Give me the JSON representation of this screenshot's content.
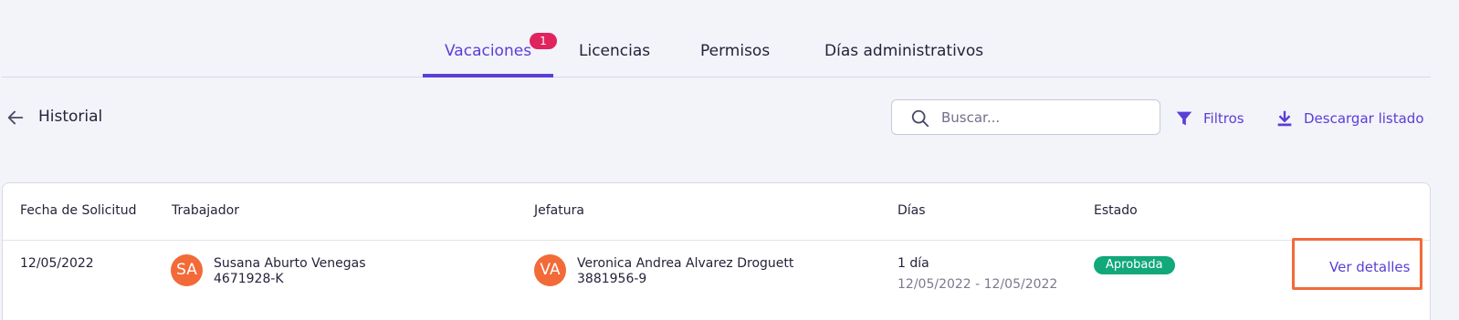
{
  "tabs": [
    {
      "label": "Vacaciones",
      "badge": "1",
      "active": true
    },
    {
      "label": "Licencias"
    },
    {
      "label": "Permisos"
    },
    {
      "label": "Días administrativos"
    }
  ],
  "section": {
    "title": "Historial"
  },
  "search": {
    "placeholder": "Buscar..."
  },
  "actions": {
    "filters_label": "Filtros",
    "download_label": "Descargar listado"
  },
  "table": {
    "headers": [
      "Fecha de Solicitud",
      "Trabajador",
      "Jefatura",
      "Días",
      "Estado"
    ],
    "rows": [
      {
        "date": "12/05/2022",
        "worker": {
          "initials": "SA",
          "name": "Susana Aburto Venegas",
          "id": "4671928-K"
        },
        "manager": {
          "initials": "VA",
          "name": "Veronica Andrea Alvarez Droguett",
          "id": "3881956-9"
        },
        "days": {
          "count": "1 día",
          "range": "12/05/2022 - 12/05/2022"
        },
        "status": "Aprobada",
        "details_label": "Ver detalles"
      }
    ]
  },
  "colors": {
    "accent": "#5b3ed6",
    "badge": "#e0245e",
    "status_ok": "#12a879",
    "avatar": "#f26a38",
    "highlight": "#f26a38"
  }
}
